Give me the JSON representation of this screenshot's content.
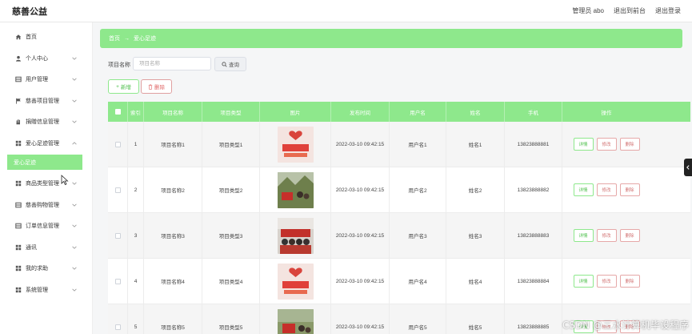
{
  "header": {
    "brand": "慈善公益",
    "admin": "管理员 abo",
    "back_front": "退出到前台",
    "logout": "退出登录"
  },
  "sidebar": {
    "items": [
      {
        "label": "首页",
        "icon": "home-icon",
        "chevron": false
      },
      {
        "label": "个人中心",
        "icon": "user-icon",
        "chevron": true
      },
      {
        "label": "用户管理",
        "icon": "grid-icon",
        "chevron": true
      },
      {
        "label": "慈善项目管理",
        "icon": "flag-icon",
        "chevron": true
      },
      {
        "label": "捐赠信息管理",
        "icon": "hand-icon",
        "chevron": true
      },
      {
        "label": "爱心足迹管理",
        "icon": "apps-icon",
        "chevron": true
      },
      {
        "label": "商品类型管理",
        "icon": "apps-icon",
        "chevron": true
      },
      {
        "label": "慈善购物管理",
        "icon": "grid-icon",
        "chevron": true
      },
      {
        "label": "订单信息管理",
        "icon": "grid-icon",
        "chevron": true
      },
      {
        "label": "通讯",
        "icon": "apps-icon",
        "chevron": true
      },
      {
        "label": "我的求助",
        "icon": "apps-icon",
        "chevron": true
      },
      {
        "label": "系统管理",
        "icon": "apps-icon",
        "chevron": true
      }
    ],
    "active_sub": "爱心足迹"
  },
  "breadcrumb": {
    "home": "首页",
    "sep": "→",
    "current": "爱心足迹"
  },
  "search": {
    "label": "项目名称",
    "placeholder": "项目名称",
    "button": "查询"
  },
  "actions": {
    "add": "新增",
    "delete": "删除"
  },
  "table": {
    "headers": {
      "idx": "索引",
      "name": "项目名称",
      "type": "项目类型",
      "img": "图片",
      "time": "发布时间",
      "user": "用户名",
      "real": "姓名",
      "phone": "手机",
      "op": "操作"
    },
    "op_labels": {
      "detail": "详情",
      "edit": "修改",
      "delete": "删除"
    },
    "rows": [
      {
        "idx": "1",
        "name": "项目名称1",
        "type": "项目类型1",
        "time": "2022-03-10 09:42:15",
        "user": "用户名1",
        "real": "姓名1",
        "phone": "13823888881"
      },
      {
        "idx": "2",
        "name": "项目名称2",
        "type": "项目类型2",
        "time": "2022-03-10 09:42:15",
        "user": "用户名2",
        "real": "姓名2",
        "phone": "13823888882"
      },
      {
        "idx": "3",
        "name": "项目名称3",
        "type": "项目类型3",
        "time": "2022-03-10 09:42:15",
        "user": "用户名3",
        "real": "姓名3",
        "phone": "13823888883"
      },
      {
        "idx": "4",
        "name": "项目名称4",
        "type": "项目类型4",
        "time": "2022-03-10 09:42:15",
        "user": "用户名4",
        "real": "姓名4",
        "phone": "13823888884"
      },
      {
        "idx": "5",
        "name": "项目名称5",
        "type": "项目类型5",
        "time": "2022-03-10 09:42:15",
        "user": "用户名5",
        "real": "姓名5",
        "phone": "13823888885"
      }
    ]
  },
  "watermark": "CSDN @三水计算机毕设程序",
  "colors": {
    "accent": "#8ee88c",
    "accent_text": "#4cbf4a",
    "danger": "#d27373"
  }
}
